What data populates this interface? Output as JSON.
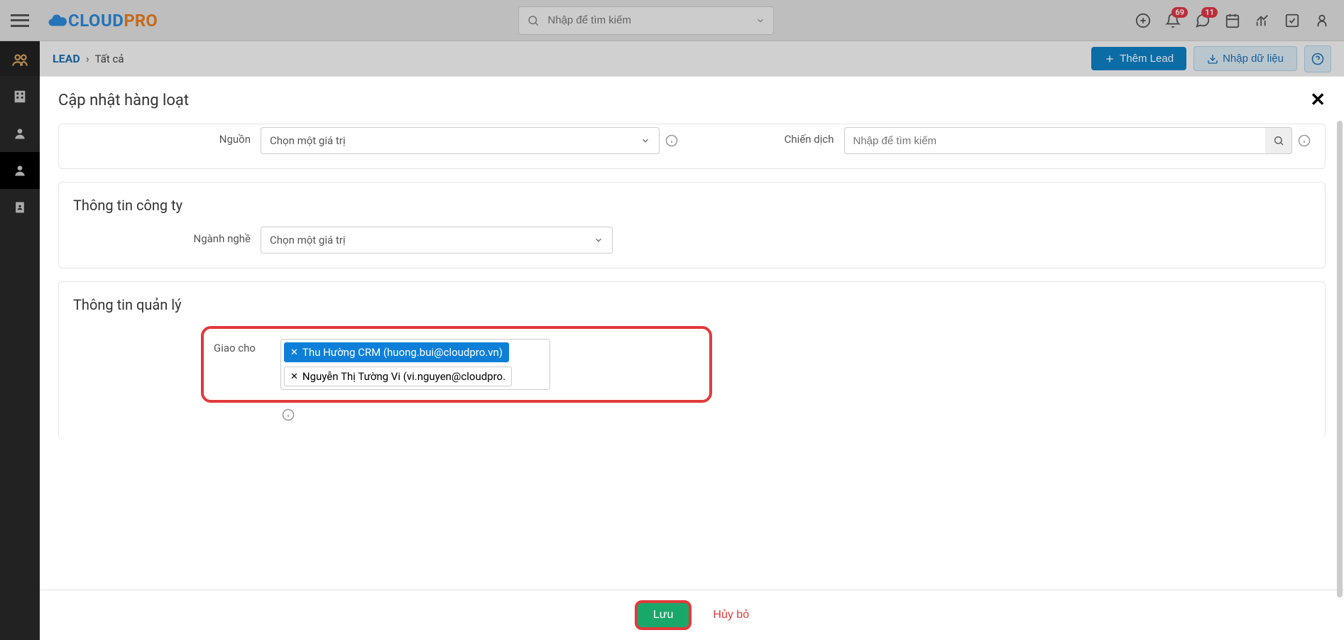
{
  "header": {
    "logo_cloud": "CLOUD",
    "logo_pro": "PRO",
    "search_placeholder": "Nhập để tìm kiếm",
    "badge_bell": "69",
    "badge_chat": "11"
  },
  "breadcrumb": {
    "module": "LEAD",
    "current": "Tất cả",
    "add_lead": "Thêm Lead",
    "import": "Nhập dữ liệu"
  },
  "modal": {
    "title": "Cập nhật hàng loạt",
    "source_label": "Nguồn",
    "source_placeholder": "Chọn một giá trị",
    "campaign_label": "Chiến dịch",
    "campaign_placeholder": "Nhập để tìm kiếm",
    "section_company": "Thông tin công ty",
    "industry_label": "Ngành nghề",
    "industry_placeholder": "Chọn một giá trị",
    "section_manage": "Thông tin quản lý",
    "assign_label": "Giao cho",
    "assignee1": "Thu Hường CRM (huong.bui@cloudpro.vn)",
    "assignee2": "Nguyễn Thị Tường Vi (vi.nguyen@cloudpro.",
    "save": "Lưu",
    "cancel": "Hủy bỏ"
  }
}
